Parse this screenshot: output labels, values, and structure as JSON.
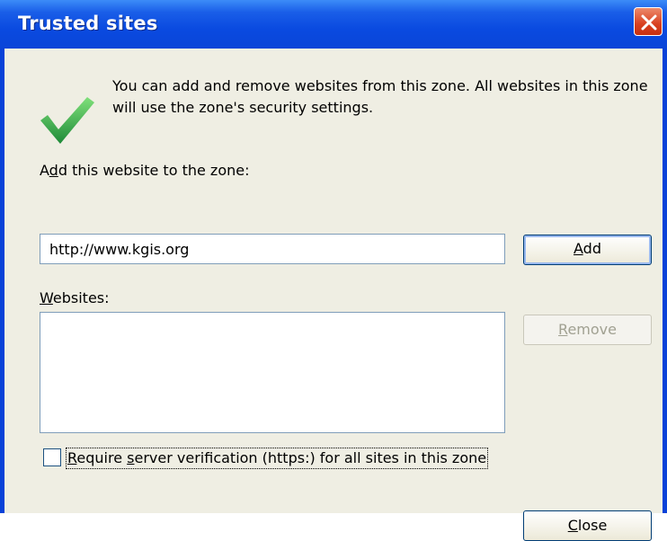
{
  "window": {
    "title": "Trusted sites"
  },
  "icons": {
    "title_close": "close-icon",
    "main": "checkmark-icon"
  },
  "colors": {
    "title_bar": "#0a4ae0",
    "client_bg": "#efeee3",
    "close_button": "#d84020",
    "check": "#2fa84a"
  },
  "description": "You can add and remove websites from this zone. All websites in this zone will use the zone's security settings.",
  "add_site": {
    "label_pre": "A",
    "label_accel": "d",
    "label_post": "d this website to the zone:",
    "input_value": "http://www.kgis.org",
    "button_accel": "A",
    "button_rest": "dd"
  },
  "websites": {
    "label_accel": "W",
    "label_rest": "ebsites:",
    "items": [],
    "remove_accel": "R",
    "remove_rest": "emove"
  },
  "https_option": {
    "checked": false,
    "label_accel": "R",
    "label_part2": "equire ",
    "label_accel2": "s",
    "label_rest": "erver verification (https:) for all sites in this zone"
  },
  "footer": {
    "close_accel": "C",
    "close_rest": "lose"
  }
}
